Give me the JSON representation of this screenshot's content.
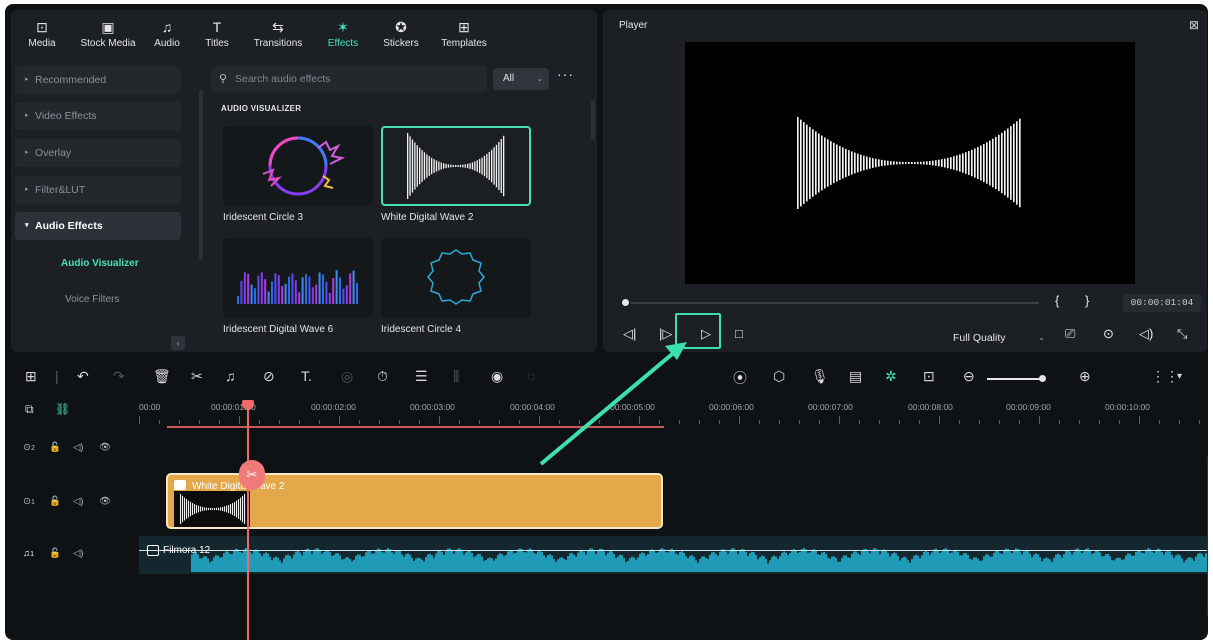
{
  "tabs": [
    {
      "label": "Media",
      "icon": "media-icon",
      "glyph": "⊡"
    },
    {
      "label": "Stock Media",
      "icon": "stock-media-icon",
      "glyph": "▣"
    },
    {
      "label": "Audio",
      "icon": "audio-note-icon",
      "glyph": "♫"
    },
    {
      "label": "Titles",
      "icon": "titles-icon",
      "glyph": "T"
    },
    {
      "label": "Transitions",
      "icon": "transitions-icon",
      "glyph": "⇆"
    },
    {
      "label": "Effects",
      "icon": "effects-icon",
      "glyph": "✶"
    },
    {
      "label": "Stickers",
      "icon": "stickers-icon",
      "glyph": "✪"
    },
    {
      "label": "Templates",
      "icon": "templates-icon",
      "glyph": "⊞"
    }
  ],
  "active_tab": "Effects",
  "sidebar": {
    "items": [
      {
        "label": "Recommended"
      },
      {
        "label": "Video Effects"
      },
      {
        "label": "Overlay"
      },
      {
        "label": "Filter&LUT"
      },
      {
        "label": "Audio Effects"
      }
    ],
    "subitems": [
      {
        "label": "Audio Visualizer"
      },
      {
        "label": "Voice Filters"
      }
    ]
  },
  "search": {
    "placeholder": "Search audio effects"
  },
  "filter": {
    "selected": "All"
  },
  "section_title": "AUDIO VISUALIZER",
  "effects": [
    {
      "label": "Iridescent Circle 3"
    },
    {
      "label": "White  Digital Wave 2"
    },
    {
      "label": "Iridescent Digital Wave 6"
    },
    {
      "label": "Iridescent Circle 4"
    }
  ],
  "player": {
    "title": "Player",
    "timecode": "00:00:01:04",
    "quality": "Full Quality",
    "progress": 0.0
  },
  "ruler": [
    "00:00",
    "00:00:01:00",
    "00:00:02:00",
    "00:00:03:00",
    "00:00:04:00",
    "00:00:05:00",
    "00:00:06:00",
    "00:00:07:00",
    "00:00:08:00",
    "00:00:09:00",
    "00:00:10:00"
  ],
  "tracks": {
    "video2": "2",
    "video1": "1",
    "audio1": "1"
  },
  "clips": {
    "video_clip": "White  Digital Wave 2",
    "audio_clip": "Filmora 12"
  },
  "colors": {
    "accent": "#48e0b8",
    "clip": "#e3a84a",
    "playhead": "#f06a6a",
    "audio_wave": "#1f9bb8"
  }
}
